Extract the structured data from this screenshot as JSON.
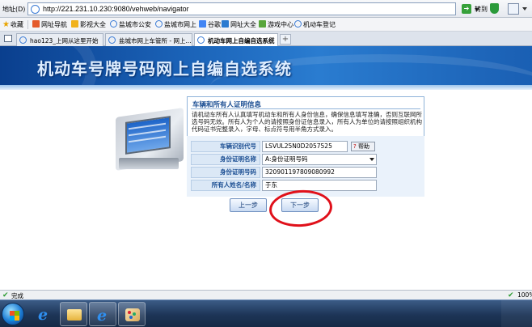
{
  "browser": {
    "address_label": "地址(D)",
    "url": "http://221.231.10.230:9080/vehweb/navigator",
    "go_label": "转到"
  },
  "favorites": {
    "label": "收藏",
    "items": [
      "网址导航",
      "影视大全",
      "盐城市公安",
      "盐城市网上",
      "谷歌",
      "网址大全",
      "游戏中心",
      "机动车登记"
    ]
  },
  "tabs": [
    {
      "label": "hao123_上网从这里开始"
    },
    {
      "label": "盐城市网上车管所 - 网上..."
    },
    {
      "label": "机动车网上自编自选系统"
    }
  ],
  "banner": {
    "title": "机动车号牌号码网上自编自选系统"
  },
  "panel": {
    "title": "车辆和所有人证明信息",
    "notice": "请机动车所有人认真填写机动车和所有人身份信息，确保信息填写准确，否则互联网所选号码无效。所有人为个人的请按照身份证信息录入，所有人为单位的请按照组织机构代码证书完整录入，字母、标点符号用半角方式录入。"
  },
  "form": {
    "vin_label": "车辆识别代号",
    "vin_value": "LSVUL25N0D2057525",
    "help_label": "帮助",
    "id_type_label": "身份证明名称",
    "id_type_value": "A:身份证明号码",
    "id_number_label": "身份证明号码",
    "id_number_value": "320901197809080992",
    "owner_label": "所有人姓名/名称",
    "owner_value": "于东"
  },
  "buttons": {
    "prev": "上一步",
    "next": "下一步"
  },
  "status": {
    "text": "完成",
    "zoom": "100%"
  },
  "colors": {
    "banner_blue": "#1b63b8",
    "label_blue": "#1c4f93",
    "annotation_red": "#e0101a"
  }
}
